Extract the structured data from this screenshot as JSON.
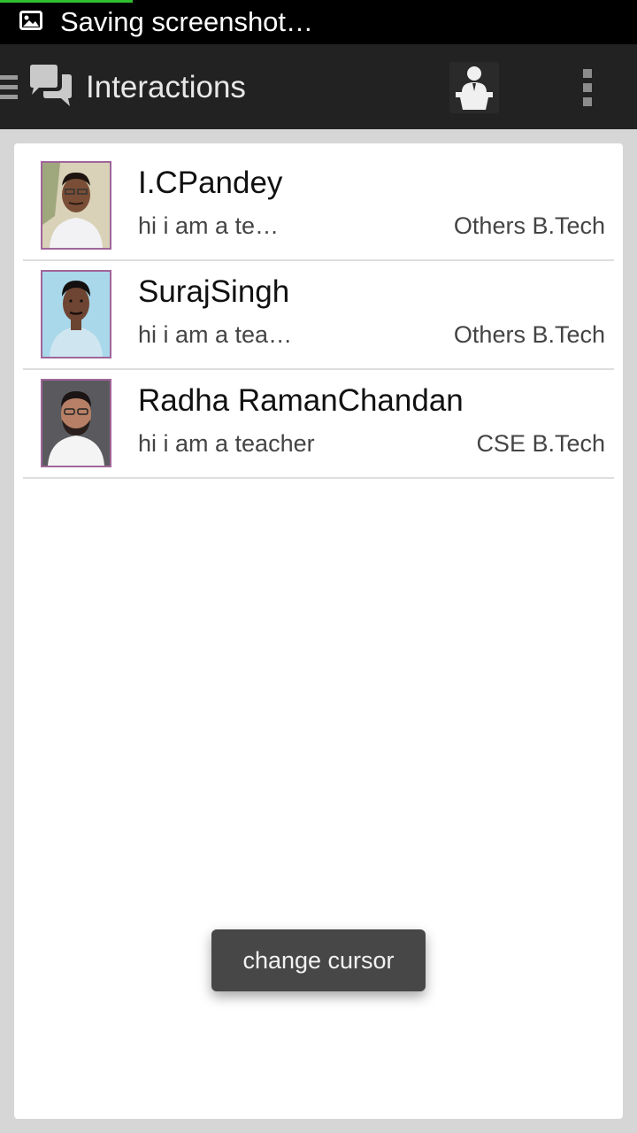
{
  "status_bar": {
    "notification_icon": "picture-icon",
    "text": "Saving screenshot…",
    "progress": 0.21,
    "progress_color": "#2fbf2f"
  },
  "action_bar": {
    "drawer_icon": "hamburger-icon",
    "app_icon": "chat-bubbles-icon",
    "title": "Interactions",
    "teacher_icon": "teacher-podium-icon",
    "overflow_icon": "overflow-menu-icon",
    "background": "#222222"
  },
  "contacts": [
    {
      "name": "I.CPandey",
      "message": "hi i am a te…",
      "department": "Others B.Tech",
      "avatar": "teacher-photo"
    },
    {
      "name": "SurajSingh",
      "message": "hi i am a tea…",
      "department": "Others B.Tech",
      "avatar": "teacher-photo"
    },
    {
      "name": "Radha RamanChandan",
      "message": "hi i am a teacher",
      "department": "CSE B.Tech",
      "avatar": "teacher-photo"
    }
  ],
  "toast": {
    "text": "change cursor"
  }
}
